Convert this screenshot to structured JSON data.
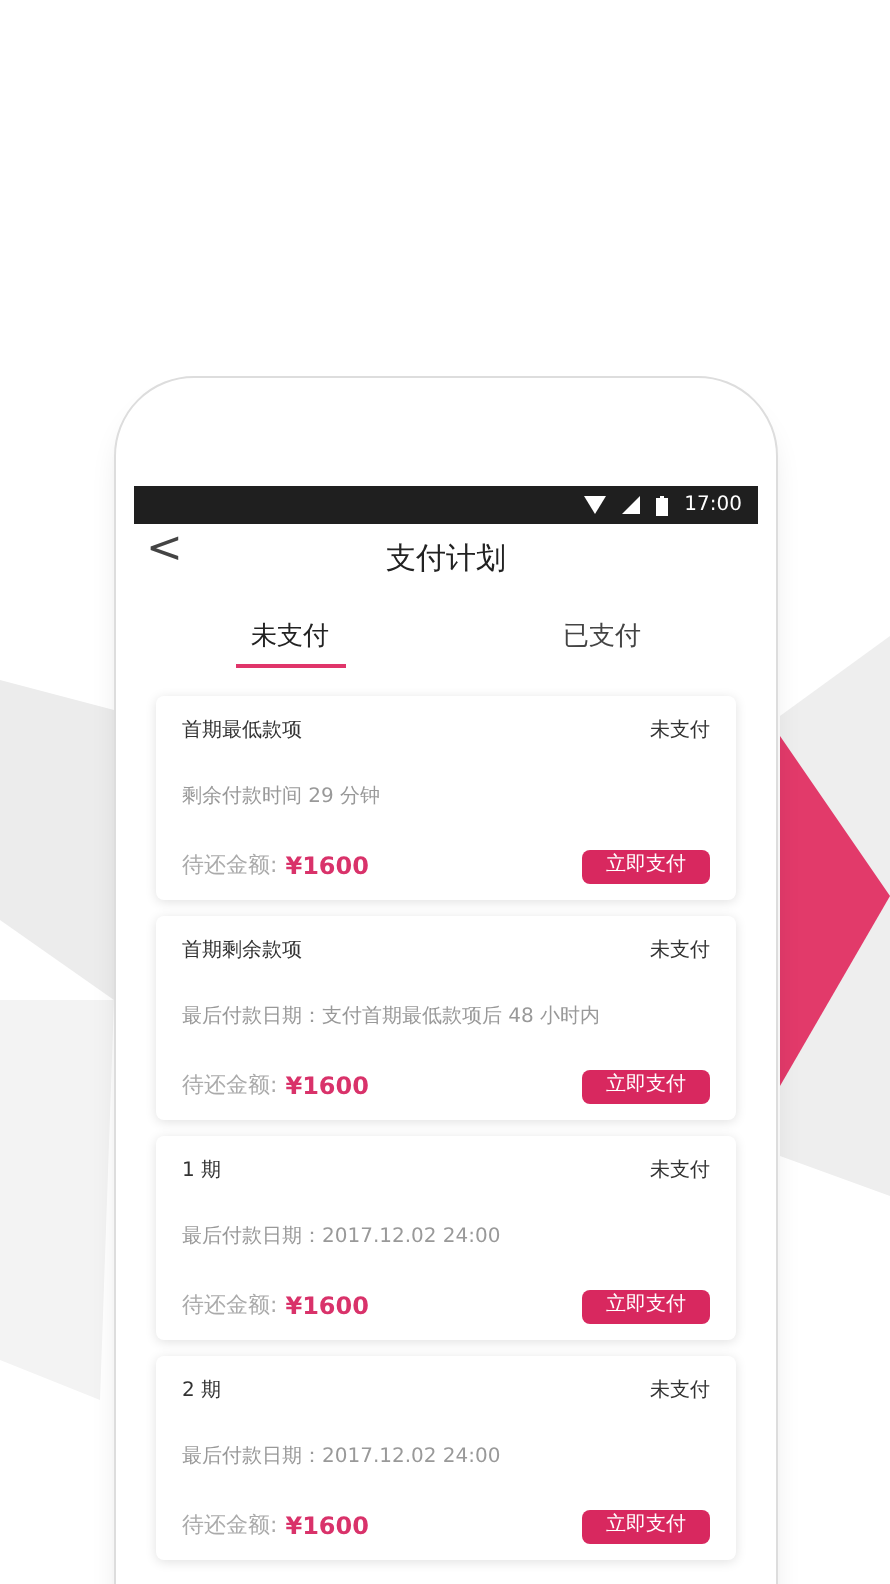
{
  "status_bar": {
    "time": "17:00"
  },
  "header": {
    "back": "<",
    "title": "支付计划"
  },
  "tabs": [
    {
      "label": "未支付",
      "selected": true
    },
    {
      "label": "已支付",
      "selected": false
    }
  ],
  "cards": [
    {
      "title": "首期最低款项",
      "status": "未支付",
      "detail": "剩余付款时间 29 分钟",
      "amount_label": "待还金额:",
      "amount": "¥1600",
      "button": "立即支付"
    },
    {
      "title": "首期剩余款项",
      "status": "未支付",
      "detail": "最后付款日期：支付首期最低款项后 48 小时内",
      "amount_label": "待还金额:",
      "amount": "¥1600",
      "button": "立即支付"
    },
    {
      "title": "1 期",
      "status": "未支付",
      "detail": "最后付款日期：2017.12.02 24:00",
      "amount_label": "待还金额:",
      "amount": "¥1600",
      "button": "立即支付"
    },
    {
      "title": "2 期",
      "status": "未支付",
      "detail": "最后付款日期：2017.12.02 24:00",
      "amount_label": "待还金额:",
      "amount": "¥1600",
      "button": "立即支付"
    }
  ]
}
